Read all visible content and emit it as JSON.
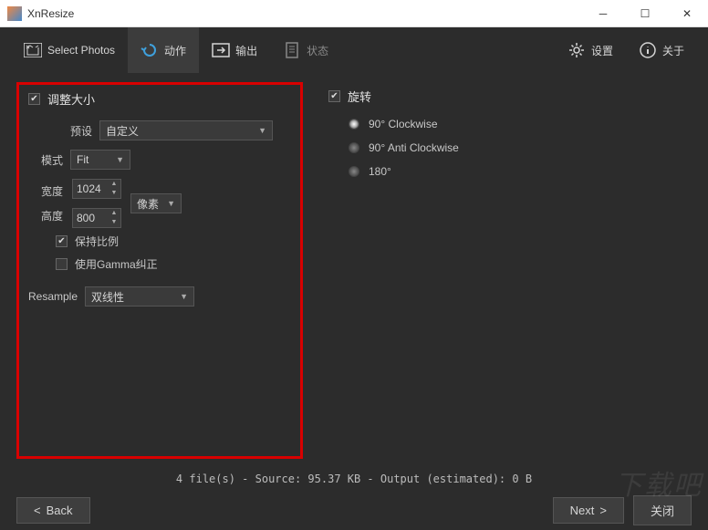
{
  "window": {
    "title": "XnResize"
  },
  "tabs": {
    "select_photos": "Select Photos",
    "action": "动作",
    "output": "输出",
    "status": "状态",
    "settings": "设置",
    "about": "关于"
  },
  "resize": {
    "title": "调整大小",
    "preset_label": "预设",
    "preset_value": "自定义",
    "mode_label": "模式",
    "mode_value": "Fit",
    "width_label": "宽度",
    "width_value": "1024",
    "height_label": "高度",
    "height_value": "800",
    "unit_value": "像素",
    "keep_ratio": "保持比例",
    "gamma": "使用Gamma纠正",
    "resample_label": "Resample",
    "resample_value": "双线性"
  },
  "rotate": {
    "title": "旋转",
    "options": [
      "90° Clockwise",
      "90° Anti Clockwise",
      "180°"
    ]
  },
  "status_text": "4 file(s) - Source: 95.37 KB - Output (estimated): 0 B",
  "buttons": {
    "back": "Back",
    "next": "Next",
    "close": "关闭"
  },
  "watermark": "下载吧"
}
